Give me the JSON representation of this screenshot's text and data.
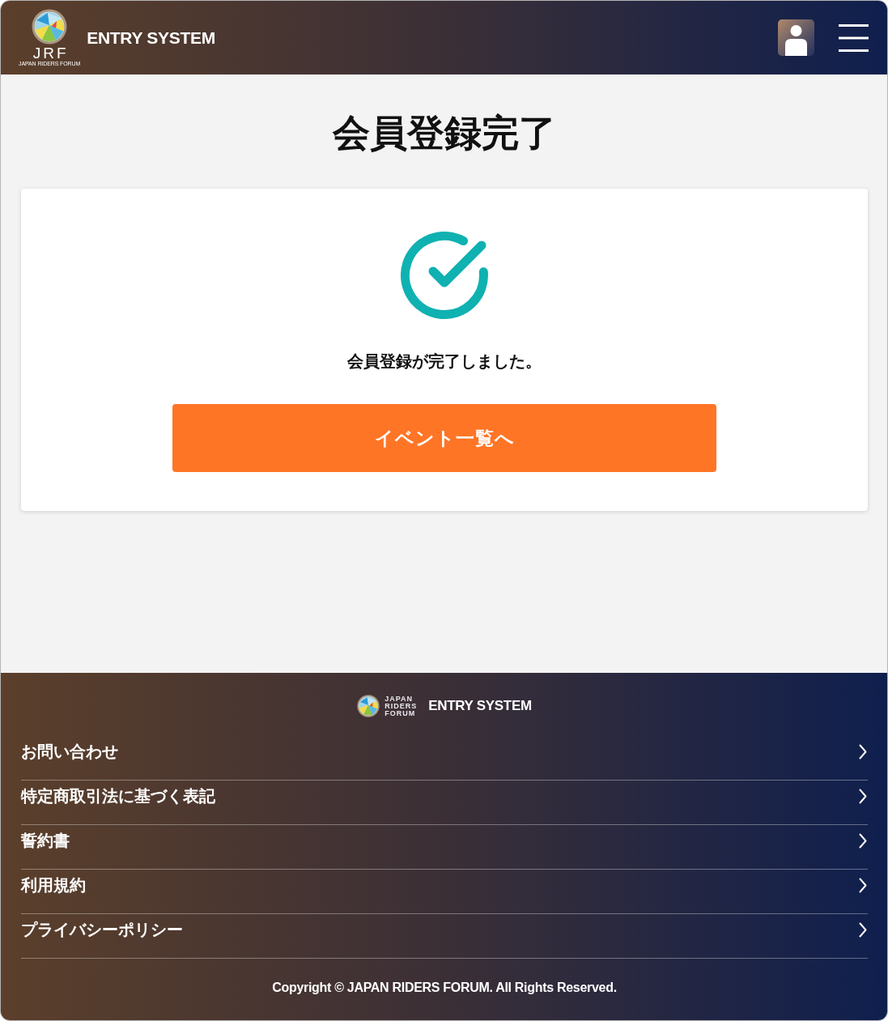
{
  "header": {
    "logo": {
      "mark_text": "JRF",
      "mark_subtext": "JAPAN RIDERS FORUM"
    },
    "title": "ENTRY SYSTEM"
  },
  "page": {
    "title": "会員登録完了"
  },
  "card": {
    "message": "会員登録が完了しました。",
    "button": "イベント一覧へ"
  },
  "footer": {
    "logo": {
      "lines": [
        "JAPAN",
        "RIDERS",
        "FORUM"
      ],
      "title": "ENTRY SYSTEM"
    },
    "links": [
      "お問い合わせ",
      "特定商取引法に基づく表記",
      "誓約書",
      "利用規約",
      "プライバシーポリシー"
    ],
    "copyright": "Copyright © JAPAN RIDERS FORUM. All Rights Reserved."
  }
}
